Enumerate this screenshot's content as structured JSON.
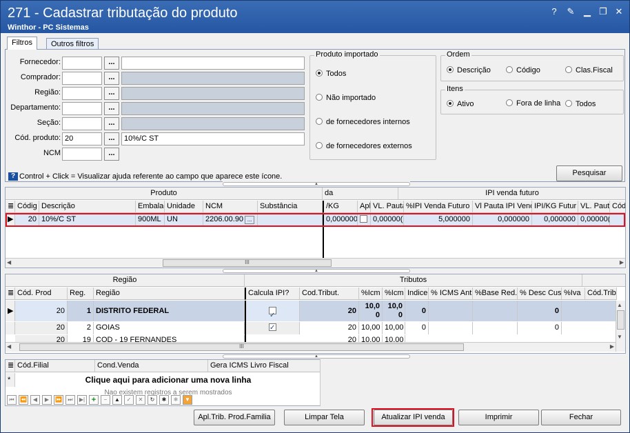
{
  "window": {
    "title": "271 - Cadastrar tributação do produto",
    "subtitle": "Winthor - PC Sistemas",
    "help": "?",
    "minimize": "▁",
    "restore": "❐",
    "close": "✕"
  },
  "tabs": [
    "Filtros",
    "Outros filtros"
  ],
  "filters": {
    "fornecedor_label": "Fornecedor:",
    "comprador_label": "Comprador:",
    "regiao_label": "Região:",
    "departamento_label": "Departamento:",
    "secao_label": "Seção:",
    "cod_produto_label": "Cód. produto:",
    "ncm_label": "NCM",
    "cod_produto_value": "20",
    "produto_desc_value": "10%/C ST",
    "dots": "..."
  },
  "produto_importado": {
    "title": "Produto importado",
    "options": [
      "Todos",
      "Não importado",
      "de fornecedores internos",
      "de fornecedores externos"
    ],
    "selected": "Todos"
  },
  "ordem": {
    "title": "Ordem",
    "options": [
      "Descrição",
      "Código",
      "Clas.Fiscal"
    ],
    "selected": "Descrição"
  },
  "itens": {
    "title": "Itens",
    "options": [
      "Ativo",
      "Fora de linha",
      "Todos"
    ],
    "selected": "Ativo"
  },
  "pesquisar_label": "Pesquisar",
  "help_hint": "Control + Click = Visualizar ajuda referente ao campo que aparece este ícone.",
  "grid1": {
    "group_produto": "Produto",
    "group_da": "da",
    "group_ipi": "IPI venda futuro",
    "columns": [
      "Códig",
      "Descrição",
      "Embalag",
      "Unidade",
      "NCM",
      "Substância",
      "/KG",
      "Apl",
      "VL. Pauta",
      "%IPI Venda Futuro",
      "Vl Pauta IPI Venda",
      "IPI/KG Futur",
      "VL. Pauta",
      "Cód"
    ],
    "row": {
      "codigo": "20",
      "descricao": "10%/C ST",
      "embalagem": "900ML",
      "unidade": "UN",
      "ncm": "2206.00.90",
      "kg": "0,000000",
      "vl_pauta": "0,00000(",
      "ipi_venda_futuro": "5,000000",
      "vl_pauta_ipi": "0,000000",
      "ipi_kg_futuro": "0,000000",
      "vl_pauta2": "0,00000("
    }
  },
  "grid2": {
    "group_regiao": "Região",
    "group_tributos": "Tributos",
    "columns": [
      "Cód. Prod",
      "Reg.",
      "Região",
      "Calcula IPI?",
      "Cod.Tribut.",
      "%Icm",
      "%Icm",
      "Indice",
      "% ICMS Ant",
      "%Base Red.",
      "% Desc Cus",
      "%Iva",
      "Cód.Trib"
    ],
    "rows": [
      {
        "cod_prod": "20",
        "reg": "1",
        "regiao": "DISTRITO FEDERAL",
        "cod_tribut": "20",
        "icm1": "10,0\n0",
        "icm2": "10,0\n0",
        "indice": "0",
        "desc_cus": "0"
      },
      {
        "cod_prod": "20",
        "reg": "2",
        "regiao": "GOIAS",
        "cod_tribut": "20",
        "icm1": "10,00",
        "icm2": "10,00",
        "indice": "0",
        "desc_cus": "0"
      },
      {
        "cod_prod": "20",
        "reg": "19",
        "regiao": "COD - 19 FERNANDES",
        "cod_tribut": "20",
        "icm1": "10,00",
        "icm2": "10,00",
        "indice": "",
        "desc_cus": ""
      }
    ]
  },
  "grid3": {
    "columns": [
      "Cód.Filial",
      "Cond.Venda",
      "Gera ICMS Livro Fiscal"
    ],
    "add_row": "Clique aqui para adicionar uma nova linha",
    "empty": "Nao existem registros a serem mostrados",
    "new_row_marker": "*"
  },
  "footer_buttons": [
    "Apl.Trib. Prod.Familia",
    "Limpar Tela",
    "Atualizar IPI venda",
    "Imprimir",
    "Fechar"
  ],
  "scroll_grip": "III"
}
